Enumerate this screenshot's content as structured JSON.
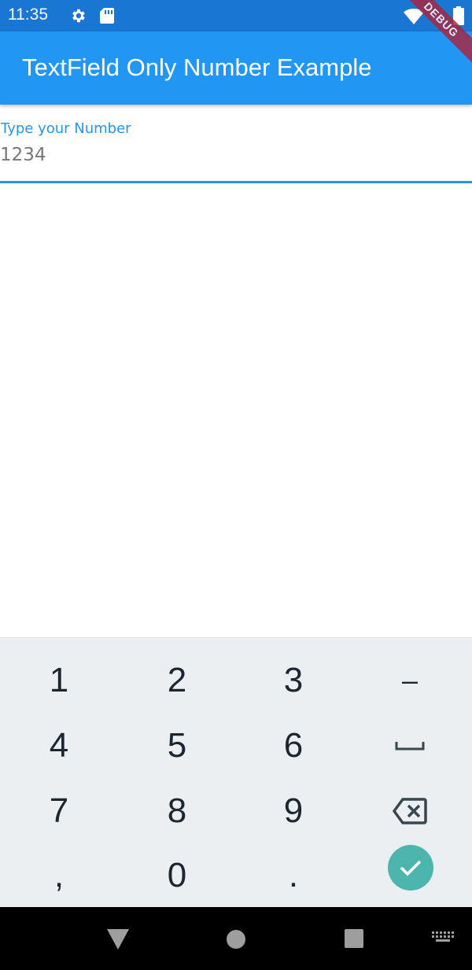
{
  "status_bar": {
    "time": "11:35",
    "icons": [
      "settings-icon",
      "sd-card-icon",
      "wifi-icon",
      "battery-icon"
    ]
  },
  "debug_banner": {
    "label": "DEBUG"
  },
  "app_bar": {
    "title": "TextField Only Number Example"
  },
  "text_field": {
    "label": "Type your Number",
    "value": "1234"
  },
  "keyboard": {
    "rows": [
      [
        "1",
        "2",
        "3",
        "–"
      ],
      [
        "4",
        "5",
        "6",
        "␣"
      ],
      [
        "7",
        "8",
        "9",
        "⌫"
      ],
      [
        ",",
        "0",
        ".",
        "✓"
      ]
    ]
  },
  "nav_bar": {
    "icons": [
      "back-icon",
      "home-icon",
      "recents-icon",
      "keyboard-switch-icon"
    ]
  },
  "colors": {
    "app_bar": "#2196f3",
    "status_bar": "#1976d2",
    "keyboard_bg": "#eceff1",
    "enter_key": "#4db6ac",
    "debug_ribbon": "#a52845"
  }
}
